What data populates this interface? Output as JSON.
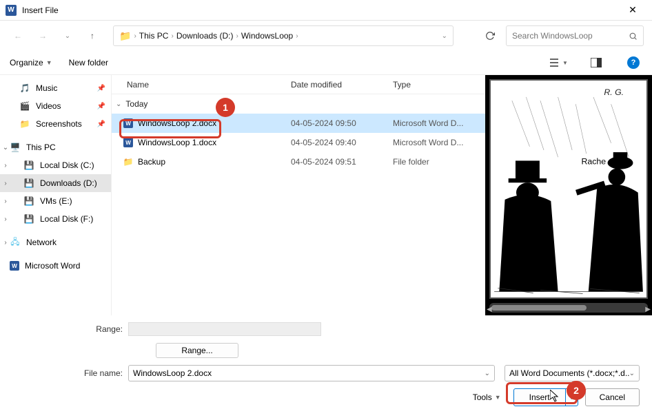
{
  "title": "Insert File",
  "breadcrumbs": [
    "This PC",
    "Downloads (D:)",
    "WindowsLoop"
  ],
  "search_placeholder": "Search WindowsLoop",
  "toolbar": {
    "organize": "Organize",
    "newfolder": "New folder"
  },
  "sidebar": {
    "quick": [
      {
        "label": "Music",
        "icon": "music"
      },
      {
        "label": "Videos",
        "icon": "videos"
      },
      {
        "label": "Screenshots",
        "icon": "folder"
      }
    ],
    "pc_label": "This PC",
    "drives": [
      {
        "label": "Local Disk (C:)"
      },
      {
        "label": "Downloads (D:)",
        "selected": true
      },
      {
        "label": "VMs (E:)"
      },
      {
        "label": "Local Disk (F:)"
      }
    ],
    "network_label": "Network",
    "word_label": "Microsoft Word"
  },
  "columns": {
    "name": "Name",
    "date": "Date modified",
    "type": "Type"
  },
  "group": "Today",
  "files": [
    {
      "name": "WindowsLoop 2.docx",
      "date": "04-05-2024 09:50",
      "type": "Microsoft Word D...",
      "kind": "docx",
      "selected": true
    },
    {
      "name": "WindowsLoop 1.docx",
      "date": "04-05-2024 09:40",
      "type": "Microsoft Word D...",
      "kind": "docx"
    },
    {
      "name": "Backup",
      "date": "04-05-2024 09:51",
      "type": "File folder",
      "kind": "folder"
    }
  ],
  "preview": {
    "initials": "R. G.",
    "word": "Rache"
  },
  "bottom": {
    "range_label": "Range:",
    "range_btn": "Range...",
    "filename_label": "File name:",
    "filename_value": "WindowsLoop 2.docx",
    "filter": "All Word Documents (*.docx;*.d...",
    "tools": "Tools",
    "insert": "Insert",
    "cancel": "Cancel"
  },
  "callouts": {
    "one": "1",
    "two": "2"
  }
}
